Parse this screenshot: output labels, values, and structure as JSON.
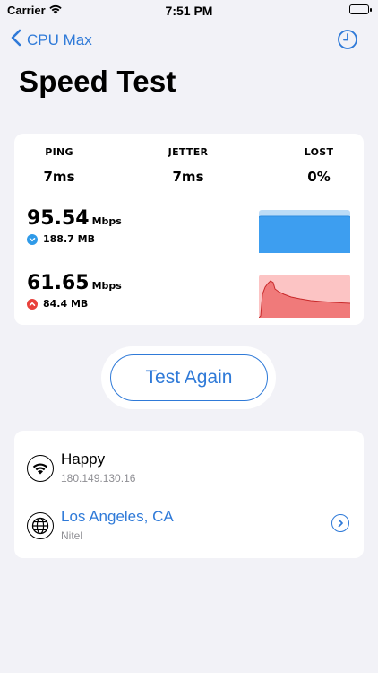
{
  "status_bar": {
    "carrier": "Carrier",
    "time": "7:51 PM"
  },
  "nav": {
    "back_label": "CPU Max",
    "history_icon": "clock-icon"
  },
  "page_title": "Speed Test",
  "metrics": {
    "ping": {
      "label": "PING",
      "value": "7ms"
    },
    "jetter": {
      "label": "JETTER",
      "value": "7ms"
    },
    "lost": {
      "label": "LOST",
      "value": "0%"
    }
  },
  "download": {
    "speed": "95.54",
    "unit": "Mbps",
    "data": "188.7 MB",
    "color": "#2f9ae8"
  },
  "upload": {
    "speed": "61.65",
    "unit": "Mbps",
    "data": "84.4 MB",
    "color": "#e8413b"
  },
  "test_again_label": "Test Again",
  "network": {
    "wifi": {
      "name": "Happy",
      "ip": "180.149.130.16"
    },
    "location": {
      "city": "Los Angeles, CA",
      "isp": "Nitel"
    }
  },
  "colors": {
    "accent": "#2f7ad8",
    "background": "#f2f2f7"
  }
}
